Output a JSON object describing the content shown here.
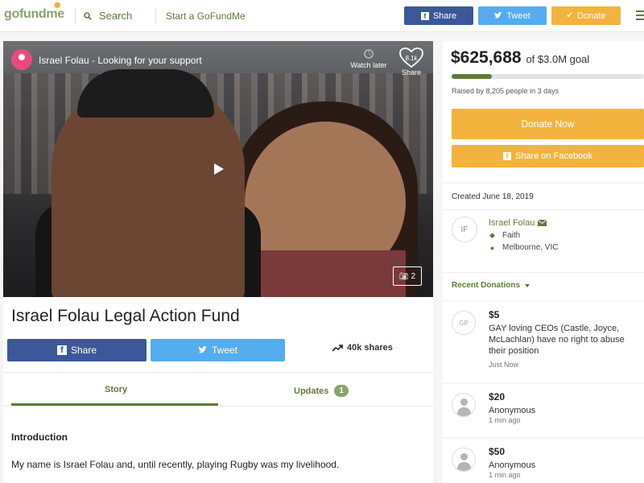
{
  "header": {
    "logo": "gofundme",
    "search_label": "Search",
    "start_label": "Start a GoFundMe",
    "share_label": "Share",
    "tweet_label": "Tweet",
    "donate_label": "Donate"
  },
  "video": {
    "title": "Israel Folau - Looking for your support",
    "watch_later": "Watch later",
    "likes": "8.1k",
    "share": "Share",
    "photo_count": "2"
  },
  "campaign": {
    "title": "Israel Folau Legal Action Fund",
    "share_button": "Share",
    "tweet_button": "Tweet",
    "shares_count": "40k shares"
  },
  "tabs": {
    "story": "Story",
    "updates": "Updates",
    "updates_count": "1"
  },
  "story": {
    "heading": "Introduction",
    "paragraph": "My name is Israel Folau and, until recently, playing Rugby was my livelihood."
  },
  "funding": {
    "raised": "$625,688",
    "goal": "of $3.0M goal",
    "progress_fraction": 0.209,
    "raised_by": "Raised by 8,205 people in 3 days",
    "donate_now": "Donate Now",
    "share_facebook": "Share on Facebook"
  },
  "organizer": {
    "created": "Created June 18, 2019",
    "initials": "IF",
    "name": "Israel Folau",
    "category": "Faith",
    "location": "Melbourne, VIC"
  },
  "recent_donations_label": "Recent Donations",
  "donations": [
    {
      "initials": "GP",
      "amount": "$5",
      "name": "GAY loving CEOs (Castle, Joyce, McLachlan) have no right to abuse their position",
      "time": "Just Now"
    },
    {
      "amount": "$20",
      "name": "Anonymous",
      "time": "1 min ago"
    },
    {
      "amount": "$50",
      "name": "Anonymous",
      "time": "1 min ago"
    }
  ],
  "colors": {
    "brand_green": "#5f7a3a",
    "donate_orange": "#f4b33e",
    "facebook_blue": "#3b5998",
    "twitter_blue": "#55acee"
  }
}
